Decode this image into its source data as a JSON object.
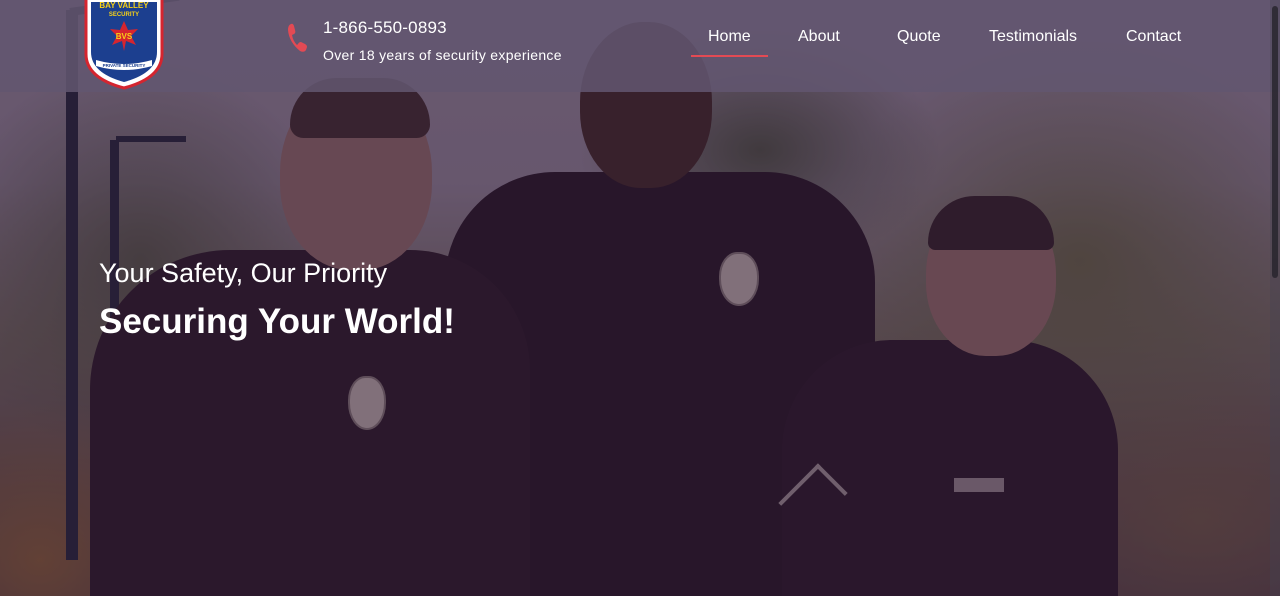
{
  "header": {
    "logo": {
      "top_text": "BAY VALLEY",
      "sub_text": "SECURITY",
      "badge_text": "BVS",
      "ribbon_text": "PRIVATE SECURITY",
      "colors": {
        "shield_fill": "#ffffff",
        "shield_border": "#d5252f",
        "banner": "#1c3f8f",
        "star": "#d5252f",
        "lettering": "#f7d117"
      }
    },
    "contact": {
      "icon": "phone-icon",
      "phone": "1-866-550-0893",
      "tagline": "Over 18 years of security experience"
    },
    "nav": {
      "items": [
        {
          "label": "Home",
          "active": true
        },
        {
          "label": "About",
          "active": false
        },
        {
          "label": "Quote",
          "active": false
        },
        {
          "label": "Testimonials",
          "active": false
        },
        {
          "label": "Contact",
          "active": false
        }
      ],
      "accent_color": "#e34a54"
    }
  },
  "hero": {
    "tagline": "Your Safety, Our Priority",
    "title": "Securing Your World!",
    "background": "three uniformed security officers in front of trees"
  }
}
